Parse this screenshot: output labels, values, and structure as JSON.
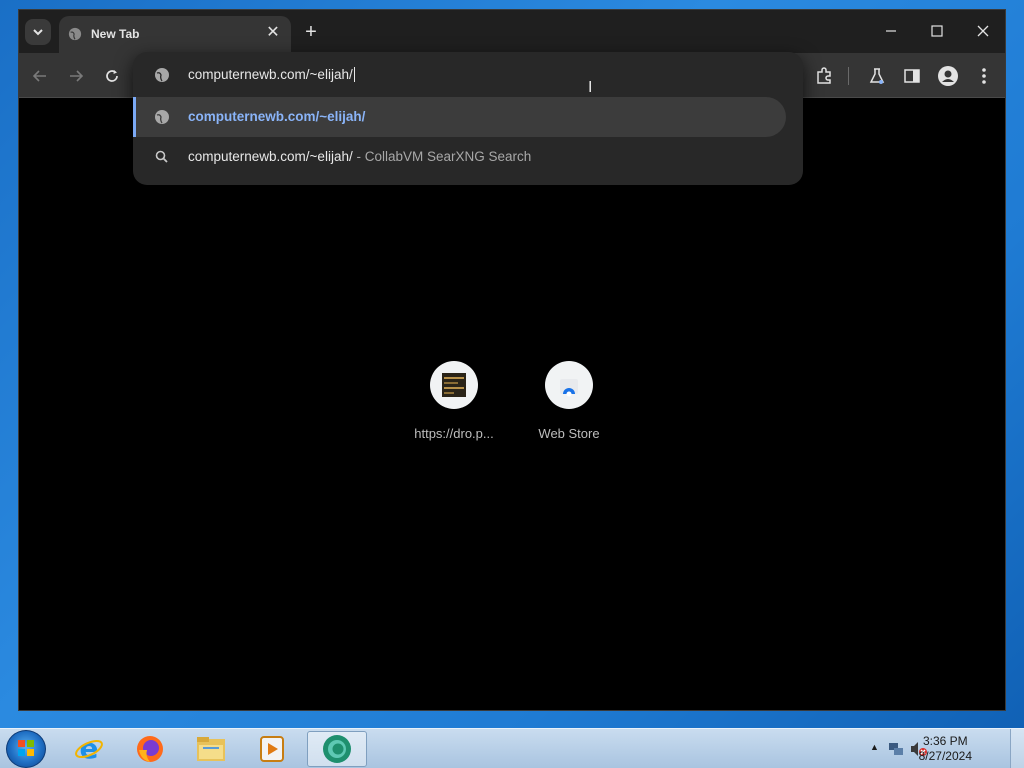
{
  "browser": {
    "tab": {
      "title": "New Tab"
    },
    "omnibox": {
      "value": "computernewb.com/~elijah/",
      "suggestions": [
        {
          "type": "url",
          "text": "computernewb.com/~elijah/",
          "desc": ""
        },
        {
          "type": "search",
          "text": "computernewb.com/~elijah/",
          "desc": "- CollabVM SearXNG Search"
        }
      ]
    },
    "shortcuts": [
      {
        "label": "https://dro.p...",
        "icon": "site-thumbnail-icon"
      },
      {
        "label": "Web Store",
        "icon": "web-store-icon"
      }
    ]
  },
  "taskbar": {
    "apps": [
      "internet-explorer-icon",
      "firefox-icon",
      "file-explorer-icon",
      "media-player-icon",
      "chrome-app-icon"
    ],
    "time": "3:36 PM",
    "date": "8/27/2024"
  },
  "colors": {
    "accent": "#8ab4f8",
    "chrome_dark": "#1f1f1f",
    "toolbar": "#353535"
  }
}
